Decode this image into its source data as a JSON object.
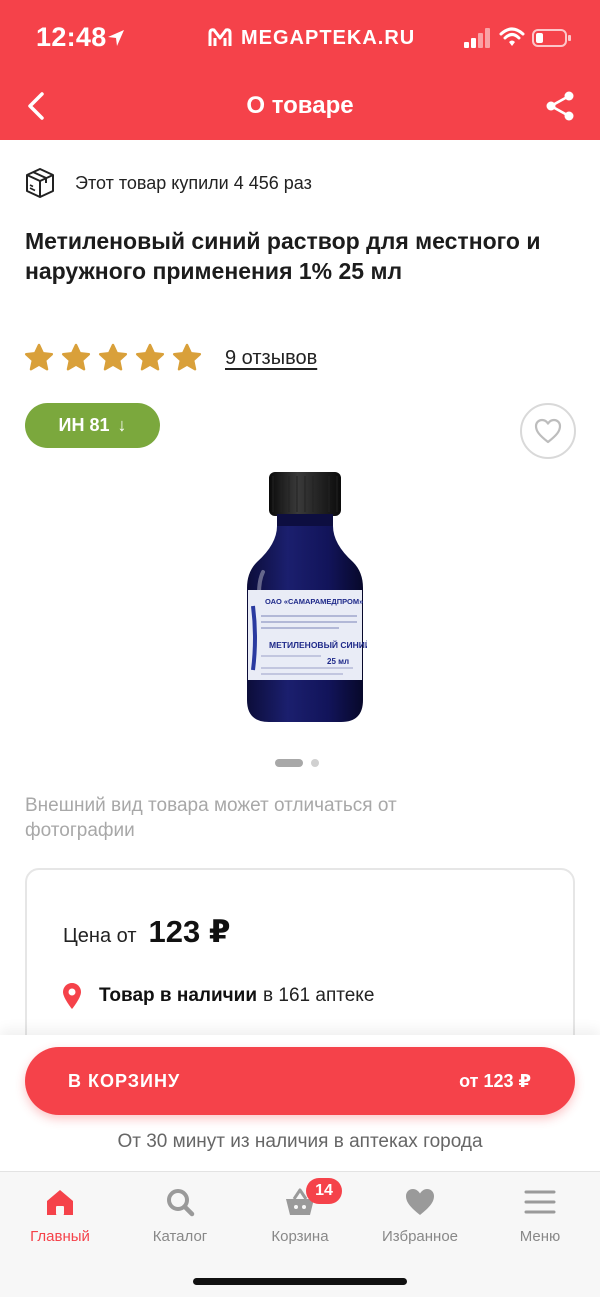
{
  "status_bar": {
    "time": "12:48",
    "site": "MEGAPTEKA.RU"
  },
  "nav": {
    "title": "О товаре"
  },
  "product": {
    "bought_text": "Этот товар купили 4 456 раз",
    "title": "Метиленовый синий раствор для местного и наружного применения 1% 25 мл",
    "rating_stars": 5,
    "reviews_label": "9 отзывов",
    "badge_label": "ИН 81",
    "badge_arrow": "↓",
    "image_label_brand": "ОАО «САМАРАМЕДПРОМ»",
    "image_label_name": "МЕТИЛЕНОВЫЙ СИНИЙ",
    "image_label_volume": "25 мл",
    "disclaimer": "Внешний вид товара может отличаться от фотографии"
  },
  "price_card": {
    "price_label": "Цена от",
    "price_value": "123 ₽",
    "stock_strong": "Товар в наличии",
    "stock_rest": "в 161 аптеке"
  },
  "cart": {
    "button_label": "В КОРЗИНУ",
    "button_price": "от 123 ₽",
    "delivery_note": "От 30 минут из наличия в аптеках города"
  },
  "tabbar": {
    "items": [
      {
        "label": "Главный",
        "icon": "home-icon",
        "active": true
      },
      {
        "label": "Каталог",
        "icon": "search-icon",
        "active": false
      },
      {
        "label": "Корзина",
        "icon": "basket-icon",
        "active": false,
        "badge": "14"
      },
      {
        "label": "Избранное",
        "icon": "heart-icon",
        "active": false
      },
      {
        "label": "Меню",
        "icon": "menu-icon",
        "active": false
      }
    ]
  },
  "colors": {
    "brand_red": "#f5424a",
    "badge_green": "#7ba83d",
    "star_gold": "#d9a03a"
  }
}
